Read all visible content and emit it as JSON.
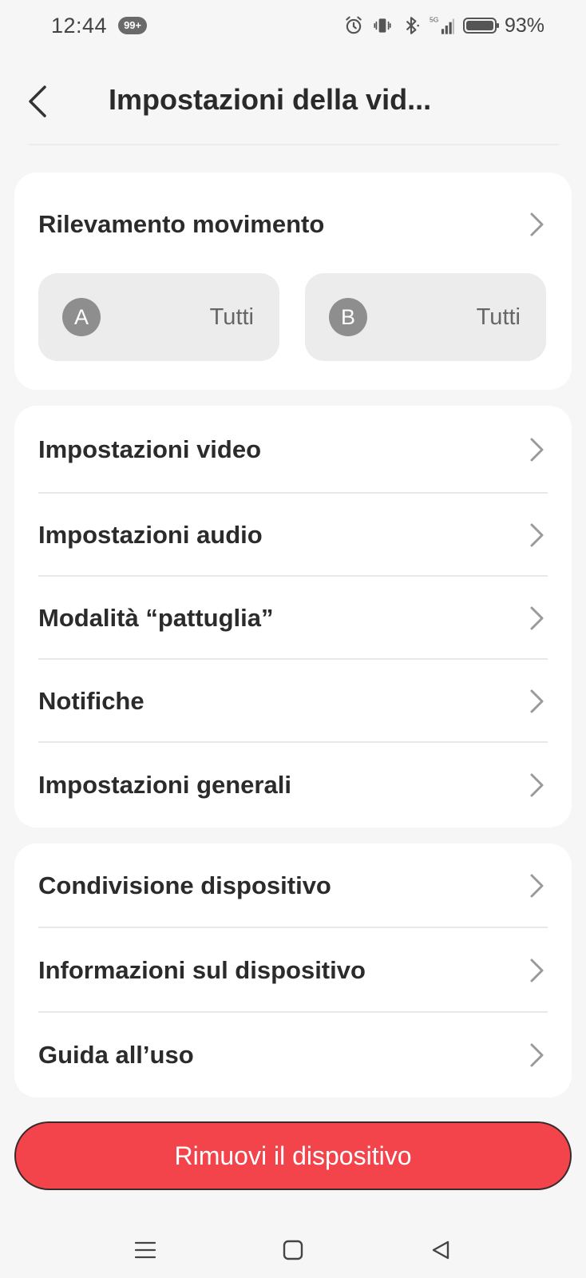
{
  "status_bar": {
    "time": "12:44",
    "notification_badge": "99+",
    "battery_percent": "93%",
    "network_label": "5G",
    "icons": [
      "alarm-icon",
      "vibrate-icon",
      "bluetooth-icon",
      "signal-icon",
      "battery-icon"
    ]
  },
  "header": {
    "title": "Impostazioni della vid...",
    "back_icon": "chevron-left-icon"
  },
  "motion_card": {
    "title": "Rilevamento movimento",
    "zones": [
      {
        "letter": "A",
        "value": "Tutti"
      },
      {
        "letter": "B",
        "value": "Tutti"
      }
    ]
  },
  "settings_card": {
    "items": [
      {
        "label": "Impostazioni video"
      },
      {
        "label": "Impostazioni audio"
      },
      {
        "label": "Modalità “pattuglia”"
      },
      {
        "label": "Notifiche"
      },
      {
        "label": "Impostazioni generali"
      }
    ]
  },
  "device_card": {
    "items": [
      {
        "label": "Condivisione dispositivo"
      },
      {
        "label": "Informazioni sul dispositivo"
      },
      {
        "label": "Guida all’uso"
      }
    ]
  },
  "remove_button": {
    "label": "Rimuovi il dispositivo"
  },
  "colors": {
    "accent_red": "#f2444a",
    "background": "#f6f6f6",
    "card": "#ffffff",
    "zone_bg": "#ececec",
    "text_primary": "#2b2b2b"
  },
  "nav_bar": {
    "icons": [
      "menu-icon",
      "home-square-icon",
      "back-triangle-icon"
    ]
  }
}
